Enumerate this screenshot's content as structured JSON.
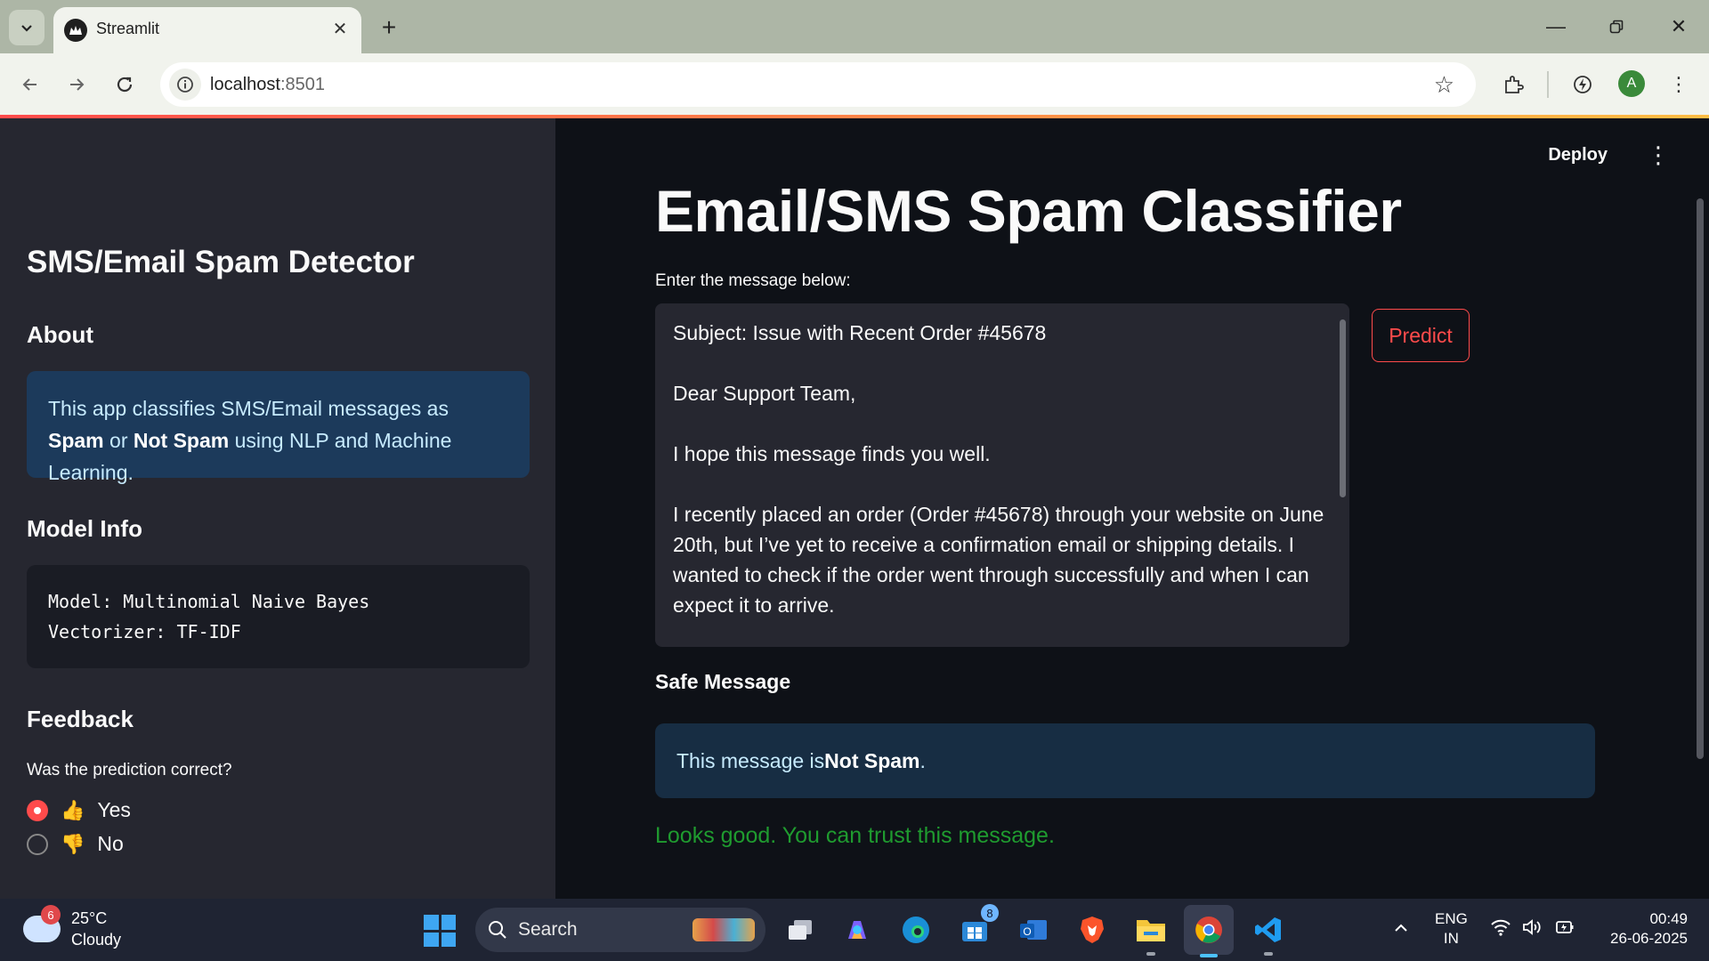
{
  "browser": {
    "tab_title": "Streamlit",
    "url_host": "localhost",
    "url_port": ":8501",
    "profile_initial": "A"
  },
  "sidebar": {
    "title": "SMS/Email Spam Detector",
    "about_heading": "About",
    "about_text_1": "This app classifies SMS/Email messages as ",
    "about_spam": "Spam",
    "about_text_2": " or ",
    "about_not_spam": "Not Spam",
    "about_text_3": " using NLP and Machine Learning.",
    "model_heading": "Model Info",
    "model_key": "Model:",
    "model_value": "Multinomial Naive Bayes",
    "vectorizer_key": "Vectorizer:",
    "vectorizer_value": "TF-IDF",
    "feedback_heading": "Feedback",
    "feedback_question": "Was the prediction correct?",
    "options": [
      {
        "emoji": "👍",
        "label": "Yes",
        "selected": true
      },
      {
        "emoji": "👎",
        "label": "No",
        "selected": false
      }
    ]
  },
  "main": {
    "deploy_label": "Deploy",
    "title": "Email/SMS Spam Classifier",
    "input_label": "Enter the message below:",
    "message": "Subject: Issue with Recent Order #45678\n\nDear Support Team,\n\nI hope this message finds you well.\n\nI recently placed an order (Order #45678) through your website on June 20th, but I’ve yet to receive a confirmation email or shipping details. I wanted to check if the order went through successfully and when I can expect it to arrive.",
    "predict_label": "Predict",
    "result_heading": "Safe Message",
    "result_text_1": "This message is ",
    "result_bold": "Not Spam",
    "result_text_2": ".",
    "good_message": "Looks good. You can trust this message."
  },
  "taskbar": {
    "weather_badge": "6",
    "temperature": "25°C",
    "condition": "Cloudy",
    "search_label": "Search",
    "mail_badge": "8",
    "lang_1": "ENG",
    "lang_2": "IN",
    "time": "00:49",
    "date": "26-06-2025"
  },
  "colors": {
    "accent": "#ff4b4b",
    "info_bg": "#1c3a5b",
    "success_text": "#1f9b2f"
  }
}
